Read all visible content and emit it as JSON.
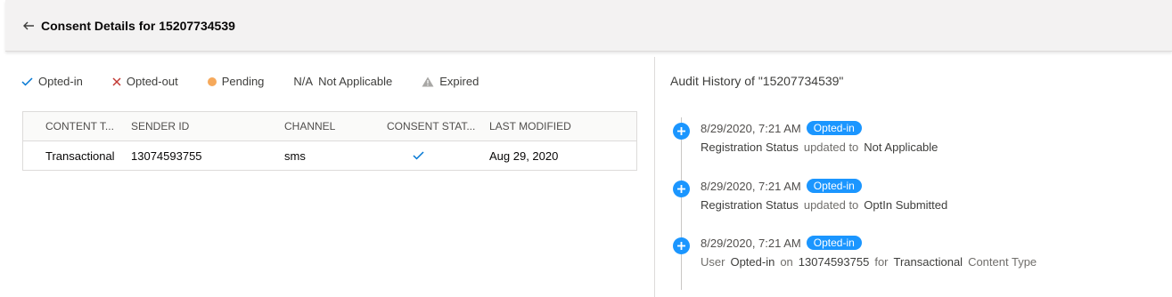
{
  "header": {
    "title": "Consent Details for 15207734539",
    "back_icon": "arrow-left-icon"
  },
  "legend": {
    "opted_in": "Opted-in",
    "opted_out": "Opted-out",
    "pending": "Pending",
    "na_symbol": "N/A",
    "not_applicable": "Not Applicable",
    "expired": "Expired"
  },
  "table": {
    "columns": [
      "CONTENT T...",
      "SENDER ID",
      "CHANNEL",
      "CONSENT STAT...",
      "LAST MODIFIED"
    ],
    "rows": [
      {
        "content_type": "Transactional",
        "sender_id": "13074593755",
        "channel": "sms",
        "consent_status": "check-icon",
        "last_modified": "Aug 29, 2020"
      }
    ]
  },
  "audit": {
    "title": "Audit History of \"15207734539\"",
    "entries": [
      {
        "date": "8/29/2020, 7:21 AM",
        "badge": "Opted-in",
        "field": "Registration Status",
        "verb": "updated to",
        "value": "Not Applicable"
      },
      {
        "date": "8/29/2020, 7:21 AM",
        "badge": "Opted-in",
        "field": "Registration Status",
        "verb": "updated to",
        "value": "OptIn Submitted"
      },
      {
        "date": "8/29/2020, 7:21 AM",
        "badge": "Opted-in",
        "w1": "User",
        "w2": "Opted-in",
        "w3": "on",
        "w4": "13074593755",
        "w5": "for",
        "w6": "Transactional",
        "w7": "Content Type"
      }
    ]
  },
  "colors": {
    "accent": "#1b96ff",
    "opted_in_check": "#0176d3",
    "opted_out_x": "#c23934",
    "pending_dot": "#f6a95b",
    "expired_triangle": "#a8a7a5"
  }
}
